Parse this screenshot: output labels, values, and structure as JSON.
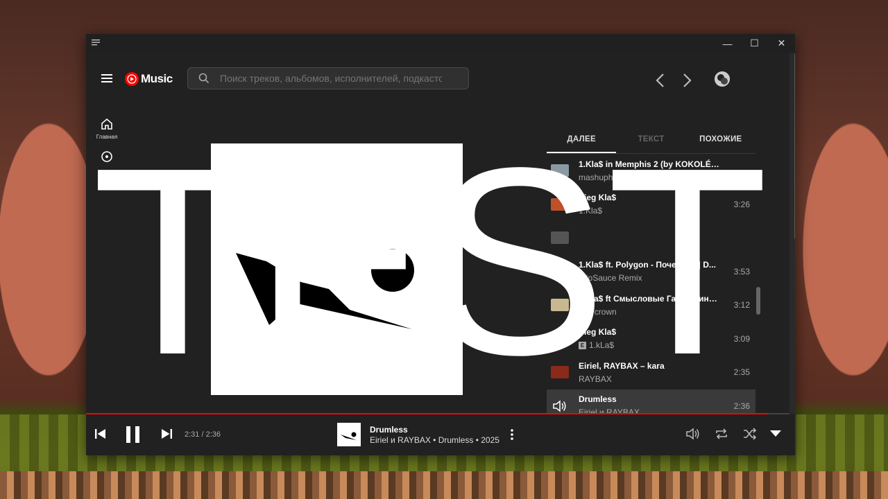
{
  "window": {
    "minimize": "—",
    "maximize": "☐",
    "close": "✕"
  },
  "header": {
    "logo_text": "Music",
    "search_placeholder": "Поиск треков, альбомов, исполнителей, подкастов"
  },
  "leftnav": {
    "items": [
      {
        "label": "Главная",
        "icon": "home-icon"
      },
      {
        "label": "",
        "icon": "explore-icon"
      }
    ]
  },
  "tabs": [
    {
      "label": "ДАЛЕЕ",
      "state": "active"
    },
    {
      "label": "ТЕКСТ",
      "state": "disabled"
    },
    {
      "label": "ПОХОЖИЕ",
      "state": "normal"
    }
  ],
  "queue": [
    {
      "title": "1.Kla$ in Memphis 2 (by KOKOLÉ) - ...",
      "artist": "mashuph",
      "explicit": false,
      "duration": "",
      "thumb": "#8a9aa0"
    },
    {
      "title": "Sieg Kla$",
      "artist": "1.Kla$",
      "explicit": false,
      "duration": "3:26",
      "thumb": "#c0502a"
    },
    {
      "title": "",
      "artist": "",
      "explicit": false,
      "duration": "",
      "thumb": "#555555"
    },
    {
      "title": "1.Kla$ ft. Polygon - Почему ... | D...",
      "artist": "TripSauce Remix",
      "explicit": false,
      "duration": "3:53",
      "thumb": "#444444"
    },
    {
      "title": "1.Kla$ ft Смысловые Галлюцинац...",
      "artist": "Ilsercrown",
      "explicit": false,
      "duration": "3:12",
      "thumb": "#c8b890"
    },
    {
      "title": "Sieg Kla$",
      "artist": "1.kLa$",
      "explicit": true,
      "duration": "3:09",
      "thumb": "#333333"
    },
    {
      "title": "Eiriel, RAYBAX – kara",
      "artist": "RAYBAX",
      "explicit": false,
      "duration": "2:35",
      "thumb": "#8a2a1a"
    },
    {
      "title": "Drumless",
      "artist": "Eiriel и RAYBAX",
      "explicit": false,
      "duration": "2:36",
      "thumb": "#ffffff",
      "playing": true
    }
  ],
  "player": {
    "time": "2:31 / 2:36",
    "progress": 0.968,
    "title": "Drumless",
    "subtitle": "Eiriel и RAYBAX • Drumless • 2025"
  },
  "overlay": {
    "text": "TEST"
  },
  "colors": {
    "accent": "#ff0000",
    "window_bg": "#212121"
  }
}
